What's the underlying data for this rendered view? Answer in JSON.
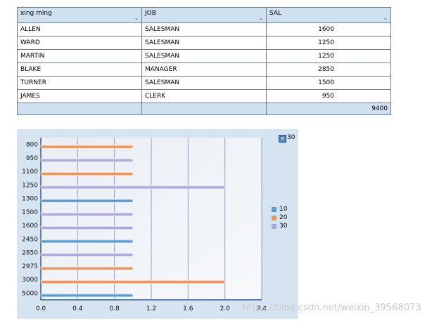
{
  "table": {
    "columns": [
      "xing ming",
      "JOB",
      "SAL"
    ],
    "rows": [
      [
        "ALLEN",
        "SALESMAN",
        "1600"
      ],
      [
        "WARD",
        "SALESMAN",
        "1250"
      ],
      [
        "MARTIN",
        "SALESMAN",
        "1250"
      ],
      [
        "BLAKE",
        "MANAGER",
        "2850"
      ],
      [
        "TURNER",
        "SALESMAN",
        "1500"
      ],
      [
        "JAMES",
        "CLERK",
        "950"
      ]
    ],
    "total": "9400",
    "sort_icon": "chevron-down-icon"
  },
  "chart_data": {
    "type": "bar",
    "orientation": "horizontal",
    "categories": [
      "800",
      "950",
      "1100",
      "1250",
      "1300",
      "1500",
      "1600",
      "2450",
      "2850",
      "2975",
      "3000",
      "5000"
    ],
    "series": [
      {
        "name": "10",
        "color": "#5b9bd5",
        "values": [
          0,
          0,
          0,
          0,
          1,
          0,
          0,
          1,
          0,
          0,
          0,
          1
        ]
      },
      {
        "name": "20",
        "color": "#f0935a",
        "values": [
          1,
          0,
          1,
          0,
          0,
          0,
          0,
          0,
          0,
          1,
          2,
          0
        ]
      },
      {
        "name": "30",
        "color": "#a8a8dc",
        "values": [
          0,
          1,
          0,
          2,
          0,
          1,
          1,
          0,
          1,
          0,
          0,
          0
        ]
      }
    ],
    "xticks": [
      "0.0",
      "0.4",
      "0.8",
      "1.2",
      "1.6",
      "2.0",
      "2.4"
    ],
    "xlim": [
      0,
      2.4
    ],
    "grid": true,
    "legend_position": "right"
  },
  "legend": {
    "close_label": "30",
    "items": [
      {
        "label": "10",
        "color": "#5b9bd5"
      },
      {
        "label": "20",
        "color": "#f0935a"
      },
      {
        "label": "30",
        "color": "#a8a8dc"
      }
    ]
  },
  "watermark": "https://blog.csdn.net/weixin_39568073"
}
